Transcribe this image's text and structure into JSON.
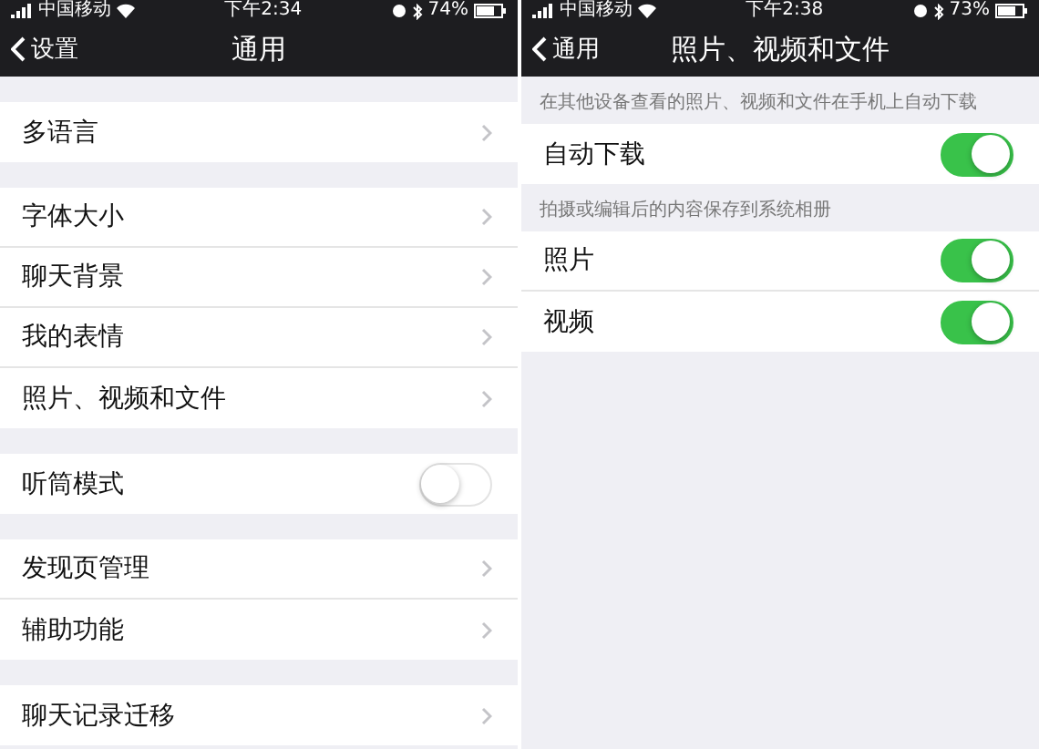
{
  "screens": [
    {
      "status_bar": {
        "carrier": "中国移动",
        "time": "下午2:34",
        "battery": "74%"
      },
      "nav": {
        "back": "设置",
        "title": "通用"
      },
      "groups": [
        {
          "rows": [
            {
              "label": "多语言",
              "kind": "link"
            }
          ]
        },
        {
          "rows": [
            {
              "label": "字体大小",
              "kind": "link"
            },
            {
              "label": "聊天背景",
              "kind": "link"
            },
            {
              "label": "我的表情",
              "kind": "link"
            },
            {
              "label": "照片、视频和文件",
              "kind": "link"
            }
          ]
        },
        {
          "rows": [
            {
              "label": "听筒模式",
              "kind": "switch",
              "on": false
            }
          ]
        },
        {
          "rows": [
            {
              "label": "发现页管理",
              "kind": "link"
            },
            {
              "label": "辅助功能",
              "kind": "link"
            }
          ]
        },
        {
          "rows": [
            {
              "label": "聊天记录迁移",
              "kind": "link"
            }
          ]
        }
      ]
    },
    {
      "status_bar": {
        "carrier": "中国移动",
        "time": "下午2:38",
        "battery": "73%"
      },
      "nav": {
        "back": "通用",
        "title": "照片、视频和文件"
      },
      "groups": [
        {
          "header": "在其他设备查看的照片、视频和文件在手机上自动下载",
          "rows": [
            {
              "label": "自动下载",
              "kind": "switch",
              "on": true
            }
          ]
        },
        {
          "header": "拍摄或编辑后的内容保存到系统相册",
          "rows": [
            {
              "label": "照片",
              "kind": "switch",
              "on": true
            },
            {
              "label": "视频",
              "kind": "switch",
              "on": true
            }
          ]
        }
      ]
    }
  ]
}
